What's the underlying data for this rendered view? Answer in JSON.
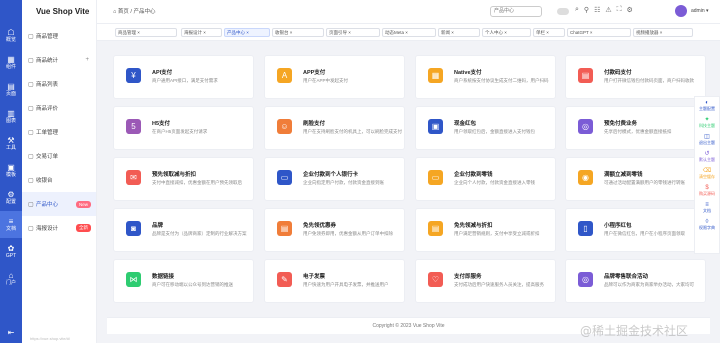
{
  "rail": {
    "items": [
      {
        "label": "概览",
        "glyph": "☖",
        "active": false
      },
      {
        "label": "组件",
        "glyph": "▦",
        "active": false
      },
      {
        "label": "页面",
        "glyph": "▤",
        "active": false
      },
      {
        "label": "图表",
        "glyph": "▥",
        "active": false
      },
      {
        "label": "工具",
        "glyph": "⚒",
        "active": false
      },
      {
        "label": "模板",
        "glyph": "▣",
        "active": false
      },
      {
        "label": "配置",
        "glyph": "⚙",
        "active": false
      },
      {
        "label": "文档",
        "glyph": "≡",
        "active": true
      },
      {
        "label": "GPT",
        "glyph": "✿",
        "active": false
      },
      {
        "label": "门户",
        "glyph": "⌂",
        "active": false
      }
    ],
    "collapse_glyph": "⇤"
  },
  "sidebar": {
    "brand": "Vue Shop Vite",
    "items": [
      {
        "label": "商品管理",
        "glyph": "▢",
        "arrow": "",
        "badge": "",
        "badge_color": "",
        "active": false
      },
      {
        "label": "商品统计",
        "glyph": "▢",
        "arrow": "+",
        "badge": "",
        "badge_color": "",
        "active": false
      },
      {
        "label": "商品列表",
        "glyph": "▢",
        "arrow": "",
        "badge": "",
        "badge_color": "",
        "active": false
      },
      {
        "label": "商品评价",
        "glyph": "▢",
        "arrow": "",
        "badge": "",
        "badge_color": "",
        "active": false
      },
      {
        "label": "工单管理",
        "glyph": "▢",
        "arrow": "",
        "badge": "",
        "badge_color": "",
        "active": false
      },
      {
        "label": "交易订单",
        "glyph": "▢",
        "arrow": "",
        "badge": "",
        "badge_color": "",
        "active": false
      },
      {
        "label": "收银台",
        "glyph": "▢",
        "arrow": "",
        "badge": "",
        "badge_color": "",
        "active": false
      },
      {
        "label": "产品中心",
        "glyph": "▢",
        "arrow": "",
        "badge": "New",
        "badge_color": "#ff6b81",
        "active": true
      },
      {
        "label": "海报设计",
        "glyph": "▢",
        "arrow": "",
        "badge": "全新",
        "badge_color": "#ff4d4f",
        "active": false
      }
    ]
  },
  "header": {
    "breadcrumb_home": "首页",
    "breadcrumb_sep": "/",
    "breadcrumb_current": "产品中心",
    "search_placeholder": "产品中心",
    "username": "admin ▾",
    "icons": [
      "⌕",
      "⚲",
      "☷",
      "⚠",
      "⛶",
      "⚙"
    ]
  },
  "tabs": [
    {
      "label": "商品管理 ×",
      "active": false
    },
    {
      "label": "海报设计 ×",
      "active": false
    },
    {
      "label": "产品中心 ×",
      "active": true
    },
    {
      "label": "收银台 ×",
      "active": false
    },
    {
      "label": "页面引导 ×",
      "active": false
    },
    {
      "label": "动态Meta ×",
      "active": false
    },
    {
      "label": "新闻 ×",
      "active": false
    },
    {
      "label": "个人中心 ×",
      "active": false
    },
    {
      "label": "单栏 ×",
      "active": false
    },
    {
      "label": "ChatGPT ×",
      "active": false
    },
    {
      "label": "视频播放器 ×",
      "active": false
    }
  ],
  "cards": [
    {
      "title": "API支付",
      "desc": "商户通用API接口，满足支付需求",
      "color": "#2f56c8",
      "glyph": "¥"
    },
    {
      "title": "APP支付",
      "desc": "用户在APP中发起支付",
      "color": "#f5a623",
      "glyph": "A"
    },
    {
      "title": "Native支付",
      "desc": "商户系统按支付协议生成支付二维码，用户扫码",
      "color": "#f5a623",
      "glyph": "▦"
    },
    {
      "title": "付款码支付",
      "desc": "用户打开微信钱包付款码页面，商户扫码收款",
      "color": "#f25c54",
      "glyph": "▤"
    },
    {
      "title": "H5支付",
      "desc": "在商户H5页面发起支付请求",
      "color": "#9b59b6",
      "glyph": "5"
    },
    {
      "title": "刷脸支付",
      "desc": "用户在支持刷脸支付的机具上，可以刷脸完成支付",
      "color": "#f07d39",
      "glyph": "☺"
    },
    {
      "title": "现金红包",
      "desc": "用户领取红包后，金额直接进入支付钱包",
      "color": "#2f56c8",
      "glyph": "▣"
    },
    {
      "title": "预免付费业务",
      "desc": "先享后付模式，优惠金额直接抵扣",
      "color": "#7b5cd6",
      "glyph": "◎"
    },
    {
      "title": "预先领取减与折扣",
      "desc": "支付中直接减扣，优惠金额在用户预先领取后",
      "color": "#f25c54",
      "glyph": "✉"
    },
    {
      "title": "企业付款到个人银行卡",
      "desc": "企业向指定用户付款，付款资金直接到账",
      "color": "#2f56c8",
      "glyph": "▭"
    },
    {
      "title": "企业付款到零钱",
      "desc": "企业向个人付款，付款资金直接进入零钱",
      "color": "#f5a623",
      "glyph": "▭"
    },
    {
      "title": "满额立减到零钱",
      "desc": "可通过活动配置满额用户的零钱进行转账",
      "color": "#f5a623",
      "glyph": "◉"
    },
    {
      "title": "品牌",
      "desc": "品牌是支付为（品牌商家）定制的行业解决方案",
      "color": "#2f56c8",
      "glyph": "◙"
    },
    {
      "title": "免先领优惠券",
      "desc": "用户免领券即用，优惠金额从用户订单中扣除",
      "color": "#f07d39",
      "glyph": "▤"
    },
    {
      "title": "免先领减与折扣",
      "desc": "用户满足营销规则，支付中享受立减或折扣",
      "color": "#f5a623",
      "glyph": "▤"
    },
    {
      "title": "小程序红包",
      "desc": "用户在微信红包，用户在小程序页面领取",
      "color": "#2f56c8",
      "glyph": "▯"
    },
    {
      "title": "数据链接",
      "desc": "商户可在移动端以公众号到达营销的推送",
      "color": "#2ecc71",
      "glyph": "⋈"
    },
    {
      "title": "电子发票",
      "desc": "用户快速为用户开具电子发票，并推送用户",
      "color": "#f25c54",
      "glyph": "✎"
    },
    {
      "title": "支付即服务",
      "desc": "支付成功后用户快速服务人员关注，提高服务",
      "color": "#f25c54",
      "glyph": "♡"
    },
    {
      "title": "品牌零售联合活动",
      "desc": "品牌可以作为商家为商家举办活动，大家均可",
      "color": "#7b5cd6",
      "glyph": "◎"
    }
  ],
  "footer": {
    "text": "Copyright © 2023 Vue Shop Vite"
  },
  "right_panel": [
    {
      "label": "主题配置",
      "glyph": "◐",
      "color": "#2f56c8"
    },
    {
      "label": "科技主题",
      "glyph": "✦",
      "color": "#2ecc71"
    },
    {
      "label": "退出主题",
      "glyph": "◫",
      "color": "#2f56c8"
    },
    {
      "label": "默认主题",
      "glyph": "↺",
      "color": "#7b5cd6"
    },
    {
      "label": "清空缓存",
      "glyph": "⌫",
      "color": "#f5a623"
    },
    {
      "label": "购买源码",
      "glyph": "$",
      "color": "#f25c54"
    },
    {
      "label": "文档",
      "glyph": "≡",
      "color": "#2f56c8"
    },
    {
      "label": "权限字典",
      "glyph": "◊",
      "color": "#2f56c8"
    }
  ],
  "watermark": "@稀土掘金技术社区",
  "url_hint": "https://vue.shop.vite/#/"
}
